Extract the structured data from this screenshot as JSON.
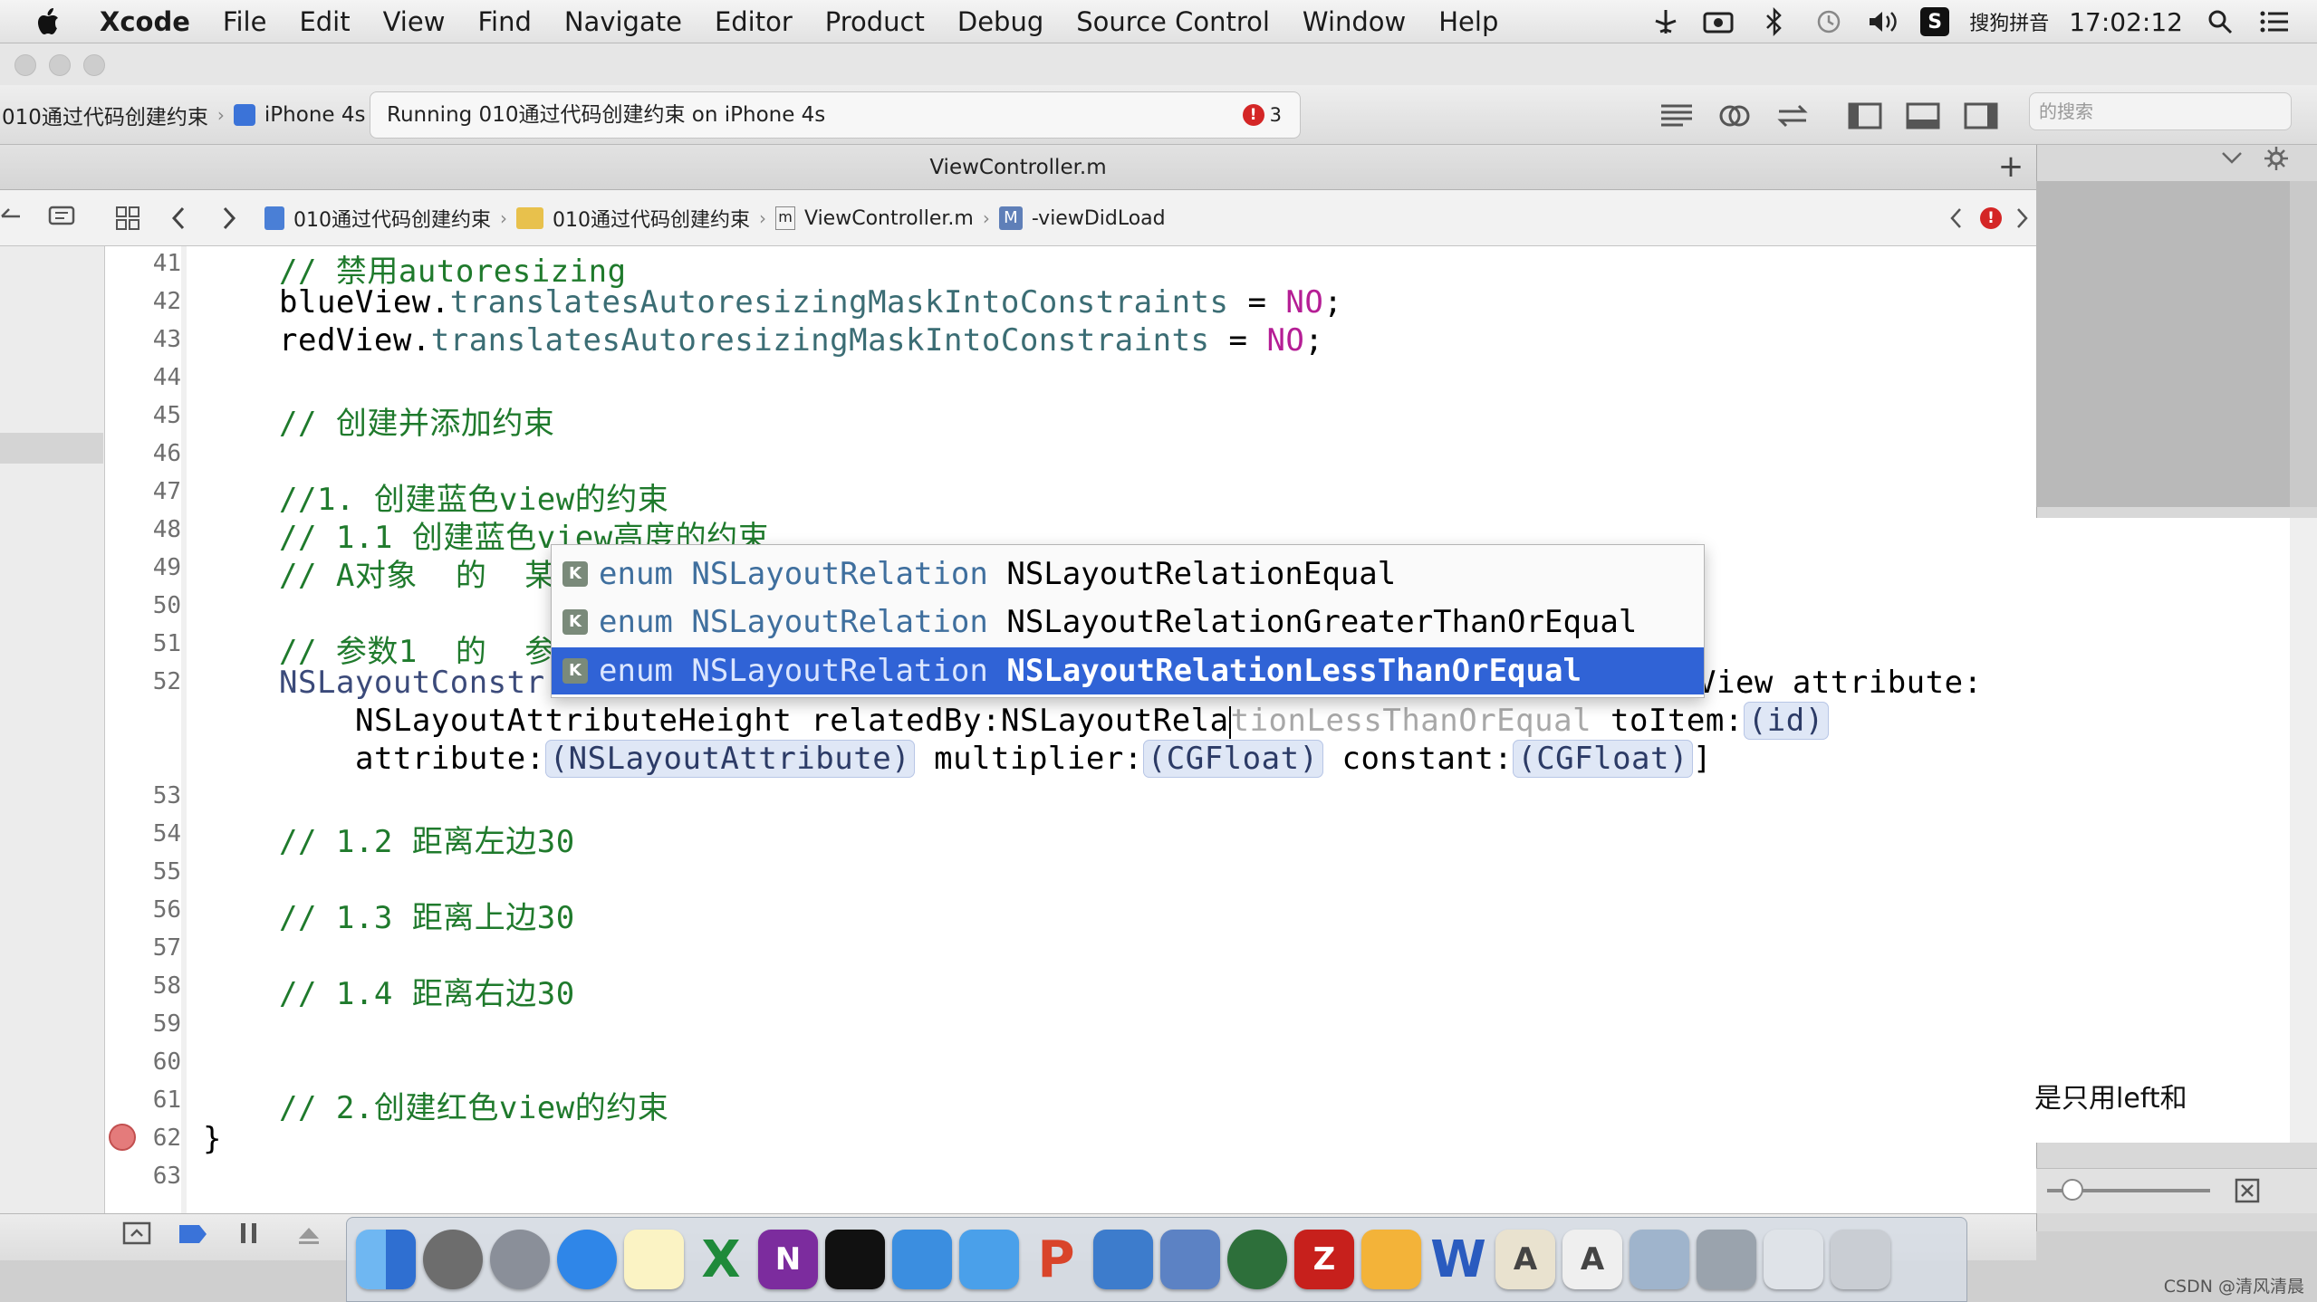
{
  "menubar": {
    "app_name": "Xcode",
    "items": [
      "File",
      "Edit",
      "View",
      "Find",
      "Navigate",
      "Editor",
      "Product",
      "Debug",
      "Source Control",
      "Window",
      "Help"
    ],
    "input_method": "搜狗拼音",
    "clock": "17:02:12"
  },
  "toolbar": {
    "scheme_name": "010通过代码创建约束",
    "device": "iPhone 4s",
    "activity_text": "Running 010通过代码创建约束 on iPhone 4s",
    "error_count": "3",
    "search_placeholder": "的搜索"
  },
  "tab": {
    "title": "ViewController.m",
    "plus": "+"
  },
  "jumpbar": {
    "crumbs": [
      "010通过代码创建约束",
      "010通过代码创建约束",
      "ViewController.m",
      "-viewDidLoad"
    ],
    "method_badge": "M",
    "file_badge": "m"
  },
  "editor": {
    "line_numbers": [
      "41",
      "42",
      "43",
      "44",
      "45",
      "46",
      "47",
      "48",
      "49",
      "50",
      "51",
      "52",
      "53",
      "54",
      "55",
      "56",
      "57",
      "58",
      "59",
      "60",
      "61",
      "62",
      "63"
    ],
    "lines": {
      "l41": "// 禁用autoresizing",
      "l42_obj": "blueView.",
      "l42_prop": "translatesAutoresizingMaskIntoConstraints",
      "l42_eq": " = ",
      "l42_val": "NO",
      "l42_end": ";",
      "l43_obj": "redView.",
      "l43_prop": "translatesAutoresizingMaskIntoConstraints",
      "l43_eq": " = ",
      "l43_val": "NO",
      "l43_end": ";",
      "l45": "// 创建并添加约束",
      "l47": "//1. 创建蓝色view的约束",
      "l48": "// 1.1 创建蓝色view高度的约束",
      "l49": "// A对象  的  某",
      "l51": "// 参数1  的  参",
      "l52_start": "NSLayoutConstr",
      "l52_end": "View attribute:",
      "l52b_typed": "NSLayoutAttributeHeight relatedBy:NSLayoutRela",
      "l52b_ghost": "tionLessThanOrEqual",
      "l52b_toitem": " toItem:",
      "l52b_ph": "(id)",
      "l52c_attr": "attribute:",
      "l52c_ph1": "(NSLayoutAttribute)",
      "l52c_mult": " multiplier:",
      "l52c_ph2": "(CGFloat)",
      "l52c_const": " constant:",
      "l52c_ph3": "(CGFloat)",
      "l52c_end": "]",
      "l54": "// 1.2 距离左边30",
      "l56": "// 1.3 距离上边30",
      "l58": "// 1.4 距离右边30",
      "l61": "// 2.创建红色view的约束",
      "l62": "}"
    }
  },
  "autocomplete": {
    "badge": "K",
    "items": [
      {
        "type": "enum NSLayoutRelation",
        "name": "NSLayoutRelationEqual"
      },
      {
        "type": "enum NSLayoutRelation",
        "name": "NSLayoutRelationGreaterThanOrEqual"
      },
      {
        "type": "enum NSLayoutRelation",
        "name": "NSLayoutRelationLessThanOrEqual"
      }
    ],
    "selected_index": 2
  },
  "right_panel": {
    "text": "是只用left和"
  },
  "dock": {
    "apps": [
      "finder",
      "system-preferences",
      "launchpad",
      "safari",
      "notes",
      "excel",
      "onenote",
      "terminal",
      "xcode",
      "folder",
      "powerpoint",
      "instruments",
      "keynote",
      "network",
      "filezilla",
      "sketch",
      "word",
      "font-book",
      "textedit",
      "preview",
      "screen-sharing",
      "trash"
    ]
  },
  "watermark": "CSDN @清风清晨",
  "colors": {
    "comment": "#1f7a2c",
    "keyword": "#b51e95",
    "property": "#3b6d74",
    "selection": "#3063d6",
    "error": "#d42626"
  }
}
